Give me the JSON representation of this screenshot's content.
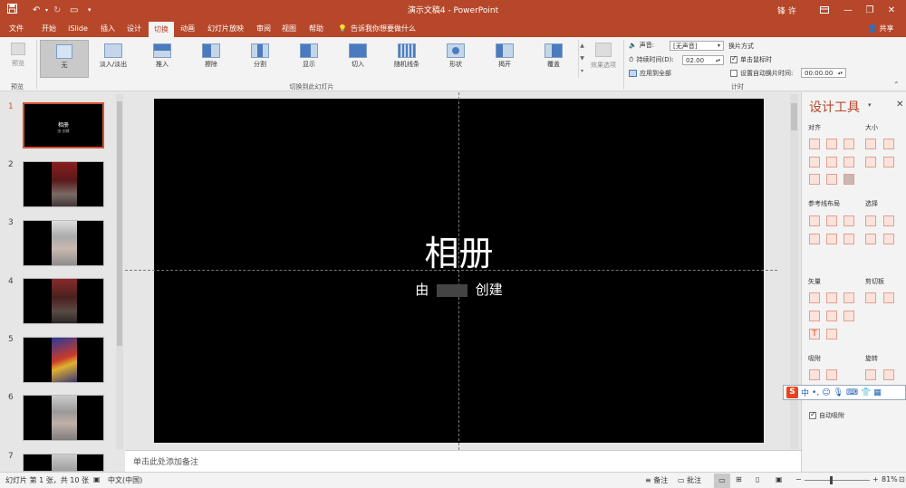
{
  "titlebar": {
    "title": "演示文稿4  -  PowerPoint",
    "user": "锋 许",
    "save_icon": "save-icon",
    "undo_icon": "undo-icon",
    "redo_icon": "redo-icon",
    "start_icon": "start-from-beginning-icon",
    "customize_icon": "customize-qat-icon",
    "restore_ribbon_icon": "ribbon-display-icon",
    "minimize": "—",
    "maximize": "❐",
    "close": "✕"
  },
  "menu": {
    "tabs": [
      "文件",
      "开始",
      "iSlide",
      "插入",
      "设计",
      "切换",
      "动画",
      "幻灯片放映",
      "审阅",
      "视图",
      "帮助"
    ],
    "active": "切换",
    "tell_me": "告诉我你想要做什么",
    "share": "共享"
  },
  "ribbon": {
    "preview_label": "预览",
    "preview_group": "预览",
    "transitions": [
      "无",
      "淡入/淡出",
      "推入",
      "擦除",
      "分割",
      "显示",
      "切入",
      "随机线条",
      "形状",
      "揭开",
      "覆盖"
    ],
    "selected_transition": "无",
    "effect_options": "效果选项",
    "group_transition": "切换到此幻灯片",
    "sound_label": "声音:",
    "sound_value": "[无声音]",
    "duration_label": "持续时间(D):",
    "duration_value": "02.00",
    "apply_all": "应用到全部",
    "advance_title": "换片方式",
    "on_click": "单击鼠标时",
    "on_click_checked": true,
    "after_label": "设置自动换片时间:",
    "after_value": "00:00.00",
    "after_checked": false,
    "group_timing": "计时"
  },
  "thumbnails": {
    "numbers": [
      "1",
      "2",
      "3",
      "4",
      "5",
      "6",
      "7"
    ],
    "slide1_title": "相册",
    "slide1_sub": "由 创建"
  },
  "slide": {
    "title": "相册",
    "subtitle_prefix": "由",
    "subtitle_suffix": "创建"
  },
  "notes": {
    "placeholder": "单击此处添加备注"
  },
  "design_panel": {
    "title": "设计工具",
    "sec_align": "对齐",
    "sec_size": "大小",
    "sec_guides": "参考线布局",
    "sec_select": "选择",
    "sec_vector": "矢量",
    "sec_clip": "剪切板",
    "sec_snap": "吸附",
    "sec_rotate": "旋转",
    "auto_snap": "自动吸附"
  },
  "ime": {
    "logo": "S",
    "mode": "中"
  },
  "status": {
    "slide_info": "幻灯片 第 1 张，共 10 张",
    "language": "中文(中国)",
    "notes": "备注",
    "comments": "批注",
    "zoom": "81%",
    "zoom_level": 0.81
  },
  "colors": {
    "accent": "#b7472a",
    "selected_thumb_border": "#d35230",
    "slide_bg": "#000000"
  }
}
